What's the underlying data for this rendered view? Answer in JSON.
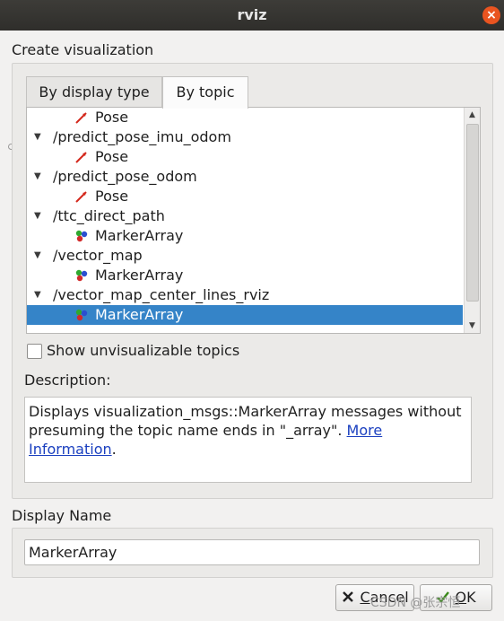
{
  "window": {
    "title": "rviz",
    "close_glyph": "×"
  },
  "create_group": {
    "title": "Create visualization"
  },
  "tabs": [
    {
      "label": "By display type",
      "active": false
    },
    {
      "label": "By topic",
      "active": true
    }
  ],
  "tree_rows": [
    {
      "label": "Pose",
      "kind": "type",
      "icon": "pose-arrow-icon",
      "selected": false
    },
    {
      "label": "/predict_pose_imu_odom",
      "kind": "topic",
      "expanded": true
    },
    {
      "label": "Pose",
      "kind": "type",
      "icon": "pose-arrow-icon",
      "selected": false
    },
    {
      "label": "/predict_pose_odom",
      "kind": "topic",
      "expanded": true
    },
    {
      "label": "Pose",
      "kind": "type",
      "icon": "pose-arrow-icon",
      "selected": false
    },
    {
      "label": "/ttc_direct_path",
      "kind": "topic",
      "expanded": true
    },
    {
      "label": "MarkerArray",
      "kind": "type",
      "icon": "marker-array-icon",
      "selected": false
    },
    {
      "label": "/vector_map",
      "kind": "topic",
      "expanded": true
    },
    {
      "label": "MarkerArray",
      "kind": "type",
      "icon": "marker-array-icon",
      "selected": false
    },
    {
      "label": "/vector_map_center_lines_rviz",
      "kind": "topic",
      "expanded": true
    },
    {
      "label": "MarkerArray",
      "kind": "type",
      "icon": "marker-array-icon",
      "selected": true
    }
  ],
  "show_unvisualizable": {
    "label": "Show unvisualizable topics",
    "checked": false
  },
  "description": {
    "title": "Description:",
    "text": "Displays visualization_msgs::MarkerArray messages without presuming the topic name ends in \"_array\". ",
    "link_text": "More Information",
    "trailing": "."
  },
  "display_name": {
    "title": "Display Name",
    "value": "MarkerArray"
  },
  "buttons": {
    "cancel": {
      "mnemonic": "C",
      "rest": "ancel"
    },
    "ok": {
      "mnemonic": "O",
      "rest": "K"
    }
  },
  "watermark": "CSDN @张宗恒",
  "colors": {
    "selection": "#3584c8",
    "close": "#e95420",
    "link": "#1a3fbf"
  }
}
